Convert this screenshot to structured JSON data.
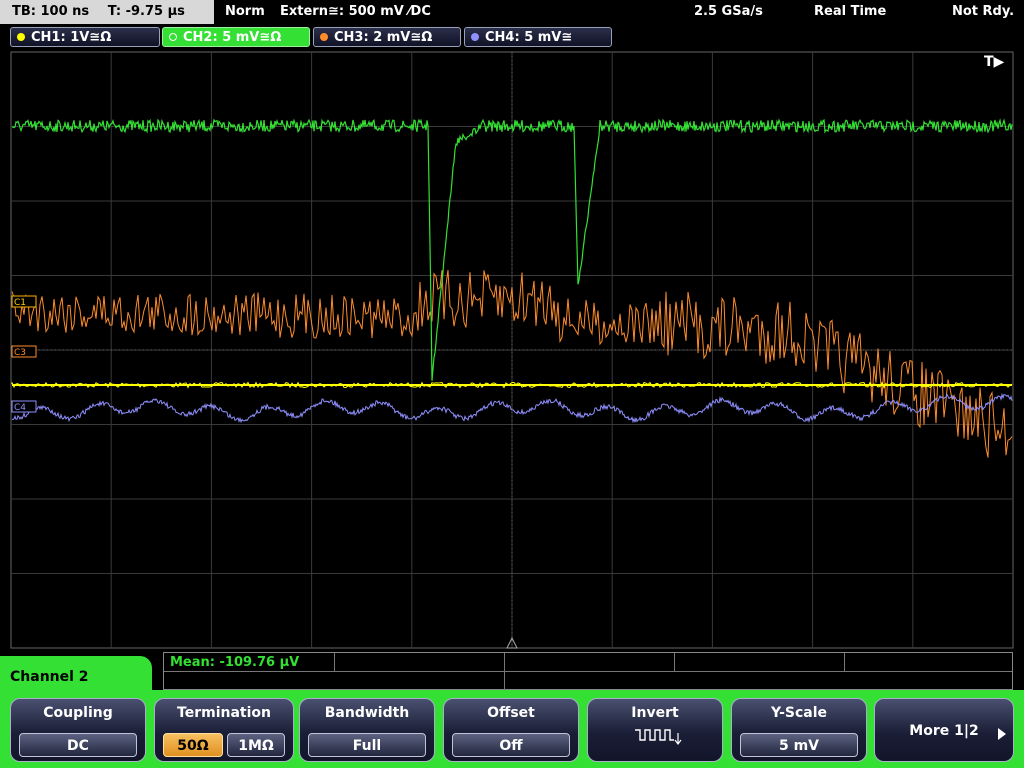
{
  "topbar": {
    "tb": "TB: 100 ns",
    "t": "T: -9.75 µs",
    "mode": "Norm",
    "trigger": "Extern≅: 500 mV ⁄DC",
    "sample_rate": "2.5 GSa/s",
    "acq": "Real Time",
    "status": "Not Rdy."
  },
  "channels": [
    {
      "label": "CH1: 1V≅Ω",
      "color": "#ffff00"
    },
    {
      "label": "CH2: 5 mV≅Ω",
      "color": "#33e033"
    },
    {
      "label": "CH3: 2 mV≅Ω",
      "color": "#ff8c2a"
    },
    {
      "label": "CH4: 5 mV≅",
      "color": "#9090ff"
    }
  ],
  "markers": {
    "trigger_pos": "T▶",
    "c1": "C1",
    "c3": "C3",
    "c4": "C4"
  },
  "measurement": {
    "mean": "Mean: -109.76 µV"
  },
  "menu": {
    "title": "Channel 2",
    "coupling": {
      "label": "Coupling",
      "value": "DC"
    },
    "termination": {
      "label": "Termination",
      "opt1": "50Ω",
      "opt2": "1MΩ"
    },
    "bandwidth": {
      "label": "Bandwidth",
      "value": "Full"
    },
    "offset": {
      "label": "Offset",
      "value": "Off"
    },
    "invert": {
      "label": "Invert",
      "icon": "inverted-pulse-icon"
    },
    "yscale": {
      "label": "Y-Scale",
      "value": "5 mV"
    },
    "more": {
      "label": "More 1|2"
    }
  },
  "colors": {
    "ch1": "#ffff00",
    "ch2": "#33e033",
    "ch3": "#ff8c2a",
    "ch4": "#9090ff",
    "menu_accent": "#33e033"
  }
}
